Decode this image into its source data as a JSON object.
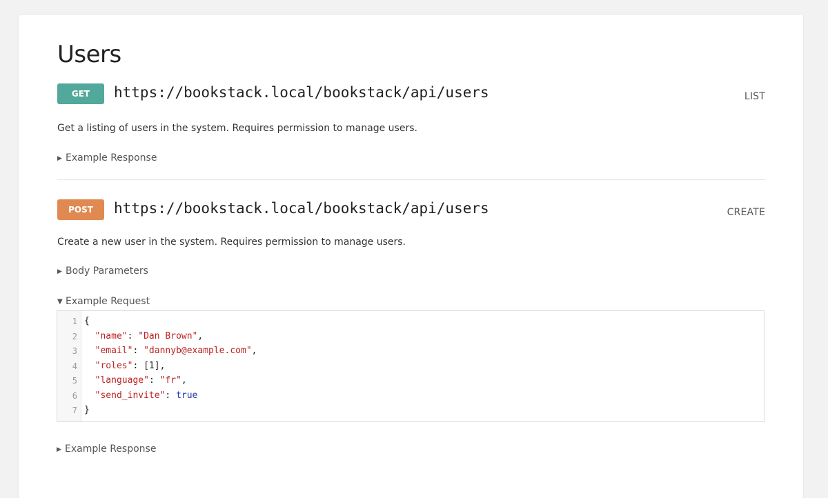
{
  "page": {
    "title": "Users"
  },
  "endpoints": [
    {
      "method": "GET",
      "method_color": "#52a89a",
      "url": "https://bookstack.local/bookstack/api/users",
      "action": "LIST",
      "description": "Get a listing of users in the system. Requires permission to manage users.",
      "sections": [
        {
          "label": "Example Response",
          "expanded": false
        }
      ]
    },
    {
      "method": "POST",
      "method_color": "#e08a52",
      "url": "https://bookstack.local/bookstack/api/users",
      "action": "CREATE",
      "description": "Create a new user in the system. Requires permission to manage users.",
      "sections": [
        {
          "label": "Body Parameters",
          "expanded": false
        },
        {
          "label": "Example Request",
          "expanded": true
        },
        {
          "label": "Example Response",
          "expanded": false
        }
      ]
    }
  ],
  "example_request": {
    "lines": [
      {
        "num": "1",
        "text": "{"
      },
      {
        "num": "2",
        "key": "\"name\"",
        "sep": ": ",
        "value": "\"Dan Brown\"",
        "value_type": "string",
        "trail": ","
      },
      {
        "num": "3",
        "key": "\"email\"",
        "sep": ": ",
        "value": "\"dannyb@example.com\"",
        "value_type": "string",
        "trail": ","
      },
      {
        "num": "4",
        "key": "\"roles\"",
        "sep": ": ",
        "value": "[1]",
        "value_type": "plain",
        "trail": ","
      },
      {
        "num": "5",
        "key": "\"language\"",
        "sep": ": ",
        "value": "\"fr\"",
        "value_type": "string",
        "trail": ","
      },
      {
        "num": "6",
        "key": "\"send_invite\"",
        "sep": ": ",
        "value": "true",
        "value_type": "bool",
        "trail": ""
      },
      {
        "num": "7",
        "text": "}"
      }
    ]
  },
  "icons": {
    "collapsed": "triangle-right-icon",
    "expanded": "triangle-down-icon"
  }
}
